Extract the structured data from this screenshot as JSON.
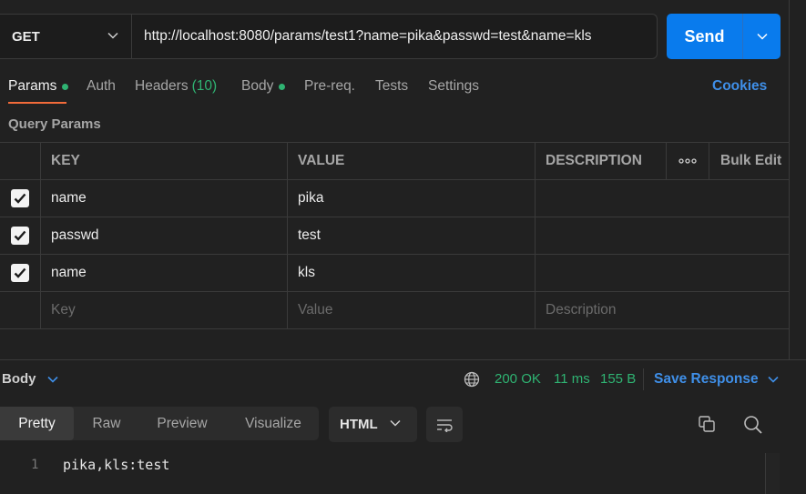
{
  "request": {
    "method": "GET",
    "url": "http://localhost:8080/params/test1?name=pika&passwd=test&name=kls",
    "send_label": "Send"
  },
  "tabs": {
    "params": "Params",
    "auth": "Auth",
    "headers": "Headers",
    "headers_count": "(10)",
    "body": "Body",
    "prereq": "Pre-req.",
    "tests": "Tests",
    "settings": "Settings",
    "cookies": "Cookies"
  },
  "query": {
    "title": "Query Params",
    "headers": {
      "key": "KEY",
      "value": "VALUE",
      "description": "DESCRIPTION",
      "more": "∘∘∘",
      "bulk_edit": "Bulk Edit"
    },
    "rows": [
      {
        "key": "name",
        "value": "pika",
        "description": "",
        "checked": true
      },
      {
        "key": "passwd",
        "value": "test",
        "description": "",
        "checked": true
      },
      {
        "key": "name",
        "value": "kls",
        "description": "",
        "checked": true
      }
    ],
    "placeholders": {
      "key": "Key",
      "value": "Value",
      "description": "Description"
    }
  },
  "response": {
    "label": "Body",
    "status": "200 OK",
    "time": "11 ms",
    "size": "155 B",
    "save_label": "Save Response",
    "view_tabs": [
      "Pretty",
      "Raw",
      "Preview",
      "Visualize"
    ],
    "format": "HTML",
    "lines": [
      {
        "num": "1",
        "text": "pika,kls:test"
      }
    ]
  },
  "colors": {
    "accent_blue": "#097bed",
    "status_green": "#2fb372",
    "active_tab_underline": "#f26b3a"
  }
}
